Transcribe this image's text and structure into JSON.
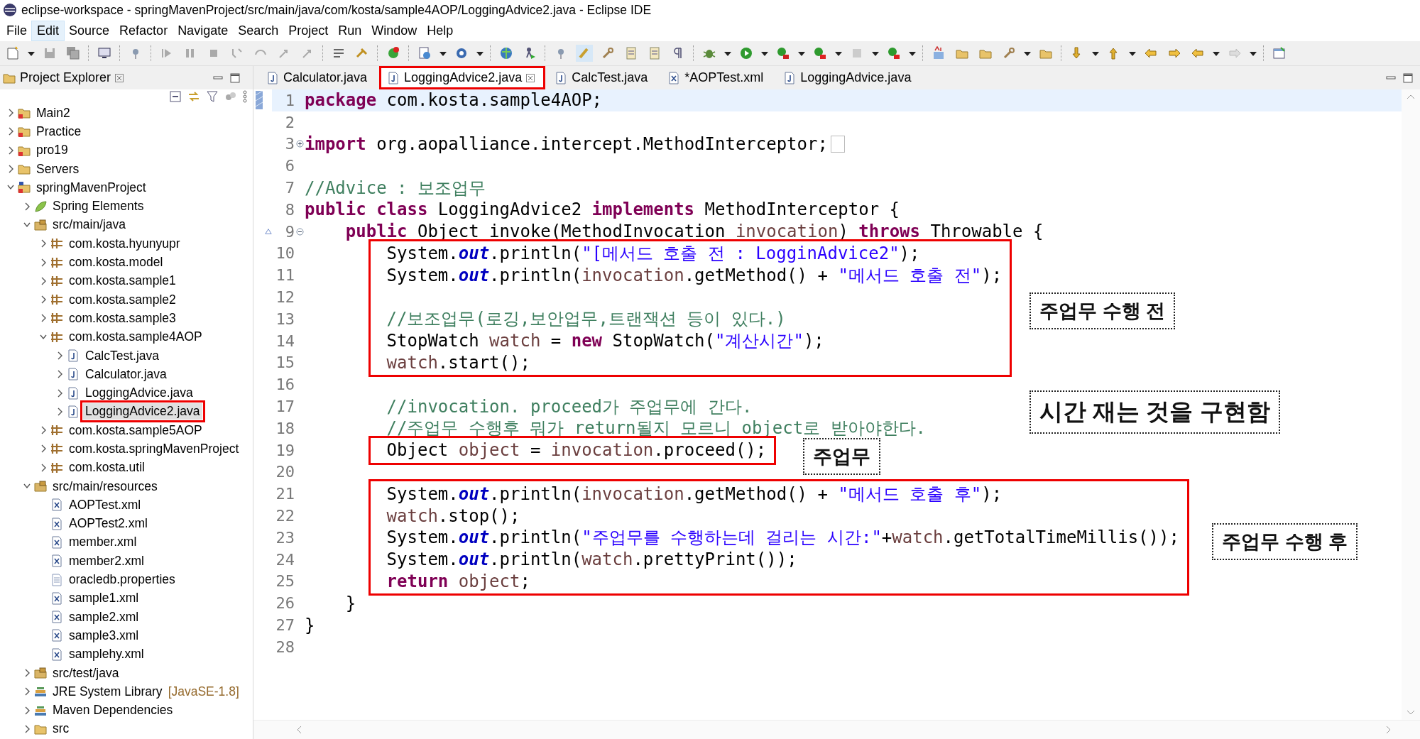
{
  "window": {
    "title": "eclipse-workspace - springMavenProject/src/main/java/com/kosta/sample4AOP/LoggingAdvice2.java - Eclipse IDE"
  },
  "menu": [
    {
      "label": "File",
      "selected": false
    },
    {
      "label": "Edit",
      "selected": true
    },
    {
      "label": "Source",
      "selected": false
    },
    {
      "label": "Refactor",
      "selected": false
    },
    {
      "label": "Navigate",
      "selected": false
    },
    {
      "label": "Search",
      "selected": false
    },
    {
      "label": "Project",
      "selected": false
    },
    {
      "label": "Run",
      "selected": false
    },
    {
      "label": "Window",
      "selected": false
    },
    {
      "label": "Help",
      "selected": false
    }
  ],
  "explorer": {
    "title": "Project Explorer",
    "items": [
      {
        "label": "Main2",
        "kind": "project",
        "expanded": false,
        "selected": false
      },
      {
        "label": "Practice",
        "kind": "project",
        "expanded": false,
        "selected": false
      },
      {
        "label": "pro19",
        "kind": "project",
        "expanded": false,
        "selected": false
      },
      {
        "label": "Servers",
        "kind": "folder",
        "expanded": false,
        "selected": false
      },
      {
        "label": "springMavenProject",
        "kind": "maven",
        "expanded": true,
        "selected": false,
        "children": [
          {
            "label": "Spring Elements",
            "kind": "spring",
            "expanded": false,
            "selected": false
          },
          {
            "label": "src/main/java",
            "kind": "source",
            "expanded": true,
            "selected": false,
            "children": [
              {
                "label": "com.kosta.hyunyupr",
                "kind": "package",
                "expanded": false,
                "selected": false
              },
              {
                "label": "com.kosta.model",
                "kind": "package",
                "expanded": false,
                "selected": false
              },
              {
                "label": "com.kosta.sample1",
                "kind": "package",
                "expanded": false,
                "selected": false
              },
              {
                "label": "com.kosta.sample2",
                "kind": "package",
                "expanded": false,
                "selected": false
              },
              {
                "label": "com.kosta.sample3",
                "kind": "package",
                "expanded": false,
                "selected": false
              },
              {
                "label": "com.kosta.sample4AOP",
                "kind": "package",
                "expanded": true,
                "selected": false,
                "children": [
                  {
                    "label": "CalcTest.java",
                    "kind": "java",
                    "expanded": false,
                    "selected": false
                  },
                  {
                    "label": "Calculator.java",
                    "kind": "java",
                    "expanded": false,
                    "selected": false
                  },
                  {
                    "label": "LoggingAdvice.java",
                    "kind": "java",
                    "expanded": false,
                    "selected": false
                  },
                  {
                    "label": "LoggingAdvice2.java",
                    "kind": "java",
                    "expanded": false,
                    "selected": true
                  }
                ]
              },
              {
                "label": "com.kosta.sample5AOP",
                "kind": "package",
                "expanded": false,
                "selected": false
              },
              {
                "label": "com.kosta.springMavenProject",
                "kind": "package",
                "expanded": false,
                "selected": false
              },
              {
                "label": "com.kosta.util",
                "kind": "package",
                "expanded": false,
                "selected": false
              }
            ]
          },
          {
            "label": "src/main/resources",
            "kind": "source",
            "expanded": true,
            "selected": false,
            "children": [
              {
                "label": "AOPTest.xml",
                "kind": "xml",
                "selected": false
              },
              {
                "label": "AOPTest2.xml",
                "kind": "xml",
                "selected": false
              },
              {
                "label": "member.xml",
                "kind": "xml",
                "selected": false
              },
              {
                "label": "member2.xml",
                "kind": "xml",
                "selected": false
              },
              {
                "label": "oracledb.properties",
                "kind": "properties",
                "selected": false
              },
              {
                "label": "sample1.xml",
                "kind": "xml",
                "selected": false
              },
              {
                "label": "sample2.xml",
                "kind": "xml",
                "selected": false
              },
              {
                "label": "sample3.xml",
                "kind": "xml",
                "selected": false
              },
              {
                "label": "samplehy.xml",
                "kind": "xml",
                "selected": false
              }
            ]
          },
          {
            "label": "src/test/java",
            "kind": "source",
            "expanded": false,
            "selected": false
          },
          {
            "label": "JRE System Library",
            "decoration": "[JavaSE-1.8]",
            "kind": "library",
            "expanded": false,
            "selected": false
          },
          {
            "label": "Maven Dependencies",
            "kind": "library",
            "expanded": false,
            "selected": false
          },
          {
            "label": "src",
            "kind": "folder",
            "expanded": false,
            "selected": false
          }
        ]
      }
    ]
  },
  "tabs": [
    {
      "label": "Calculator.java",
      "kind": "java",
      "selected": false
    },
    {
      "label": "LoggingAdvice2.java",
      "kind": "java",
      "selected": true
    },
    {
      "label": "CalcTest.java",
      "kind": "java",
      "selected": false
    },
    {
      "label": "*AOPTest.xml",
      "kind": "xml",
      "selected": false
    },
    {
      "label": "LoggingAdvice.java",
      "kind": "java",
      "selected": false
    }
  ],
  "code": [
    {
      "number": "1",
      "current": true,
      "changed": true,
      "override": false,
      "boxed": false,
      "tokens": [
        {
          "kind": "keyword",
          "text": "package"
        },
        {
          "kind": "plain",
          "text": " com.kosta.sample4AOP;"
        }
      ]
    },
    {
      "number": "2",
      "current": false,
      "changed": false,
      "override": false,
      "boxed": false
    },
    {
      "number": "3",
      "current": false,
      "changed": false,
      "override": false,
      "boxed": false,
      "folded": true,
      "tokens": [
        {
          "kind": "keyword",
          "text": "import"
        },
        {
          "kind": "plain",
          "text": " org.aopalliance.intercept.MethodInterceptor;"
        }
      ]
    },
    {
      "number": "6",
      "current": false,
      "changed": false,
      "override": false,
      "boxed": false
    },
    {
      "number": "7",
      "current": false,
      "changed": false,
      "override": false,
      "boxed": false,
      "tokens": [
        {
          "kind": "comment",
          "text": "//Advice : 보조업무"
        }
      ]
    },
    {
      "number": "8",
      "current": false,
      "changed": false,
      "override": false,
      "boxed": false,
      "tokens": [
        {
          "kind": "keyword",
          "text": "public class"
        },
        {
          "kind": "plain",
          "text": " LoggingAdvice2 "
        },
        {
          "kind": "keyword",
          "text": "implements"
        },
        {
          "kind": "plain",
          "text": " MethodInterceptor {"
        }
      ],
      "children": [
        {
          "number": "9",
          "current": false,
          "changed": false,
          "override": true,
          "boxed": false,
          "folded": false,
          "tokens": [
            {
              "kind": "keyword",
              "text": "public"
            },
            {
              "kind": "plain",
              "text": " Object invoke(MethodInvocation "
            },
            {
              "kind": "variable",
              "text": "invocation"
            },
            {
              "kind": "plain",
              "text": ") "
            },
            {
              "kind": "keyword",
              "text": "throws"
            },
            {
              "kind": "plain",
              "text": " Throwable {"
            }
          ],
          "children": [
            {
              "number": "10",
              "current": false,
              "changed": false,
              "override": false,
              "boxed": true,
              "tokens": [
                {
                  "kind": "plain",
                  "text": "System."
                },
                {
                  "kind": "field",
                  "text": "out"
                },
                {
                  "kind": "plain",
                  "text": ".println("
                },
                {
                  "kind": "string",
                  "text": "\"[메서드 호출 전 : LogginAdvice2\""
                },
                {
                  "kind": "plain",
                  "text": ");"
                }
              ]
            },
            {
              "number": "11",
              "current": false,
              "changed": false,
              "override": false,
              "boxed": true,
              "tokens": [
                {
                  "kind": "plain",
                  "text": "System."
                },
                {
                  "kind": "field",
                  "text": "out"
                },
                {
                  "kind": "plain",
                  "text": ".println("
                },
                {
                  "kind": "variable",
                  "text": "invocation"
                },
                {
                  "kind": "plain",
                  "text": ".getMethod() + "
                },
                {
                  "kind": "string",
                  "text": "\"메서드 호출 전\""
                },
                {
                  "kind": "plain",
                  "text": ");"
                }
              ]
            },
            {
              "number": "12",
              "current": false,
              "changed": false,
              "override": false,
              "boxed": true
            },
            {
              "number": "13",
              "current": false,
              "changed": false,
              "override": false,
              "boxed": true,
              "tokens": [
                {
                  "kind": "comment",
                  "text": "//보조업무(로깅,보안업무,트랜잭션 등이 있다.)"
                }
              ]
            },
            {
              "number": "14",
              "current": false,
              "changed": false,
              "override": false,
              "boxed": true,
              "tokens": [
                {
                  "kind": "plain",
                  "text": "StopWatch "
                },
                {
                  "kind": "variable",
                  "text": "watch"
                },
                {
                  "kind": "plain",
                  "text": " = "
                },
                {
                  "kind": "keyword",
                  "text": "new"
                },
                {
                  "kind": "plain",
                  "text": " StopWatch("
                },
                {
                  "kind": "string",
                  "text": "\"계산시간\""
                },
                {
                  "kind": "plain",
                  "text": ");"
                }
              ]
            },
            {
              "number": "15",
              "current": false,
              "changed": false,
              "override": false,
              "boxed": true,
              "tokens": [
                {
                  "kind": "variable",
                  "text": "watch"
                },
                {
                  "kind": "plain",
                  "text": ".start();"
                }
              ]
            },
            {
              "number": "16",
              "current": false,
              "changed": false,
              "override": false,
              "boxed": false
            },
            {
              "number": "17",
              "current": false,
              "changed": false,
              "override": false,
              "boxed": false,
              "tokens": [
                {
                  "kind": "comment",
                  "text": "//invocation. proceed가 주업무에 간다."
                }
              ]
            },
            {
              "number": "18",
              "current": false,
              "changed": false,
              "override": false,
              "boxed": false,
              "tokens": [
                {
                  "kind": "comment",
                  "text": "//주업무 수행후 뭐가 return될지 모르니 object로 받아야한다."
                }
              ]
            },
            {
              "number": "19",
              "current": false,
              "changed": false,
              "override": false,
              "boxed": true,
              "tokens": [
                {
                  "kind": "plain",
                  "text": "Object "
                },
                {
                  "kind": "variable",
                  "text": "object"
                },
                {
                  "kind": "plain",
                  "text": " = "
                },
                {
                  "kind": "variable",
                  "text": "invocation"
                },
                {
                  "kind": "plain",
                  "text": ".proceed();"
                }
              ]
            },
            {
              "number": "20",
              "current": false,
              "changed": false,
              "override": false,
              "boxed": false
            },
            {
              "number": "21",
              "current": false,
              "changed": false,
              "override": false,
              "boxed": true,
              "tokens": [
                {
                  "kind": "plain",
                  "text": "System."
                },
                {
                  "kind": "field",
                  "text": "out"
                },
                {
                  "kind": "plain",
                  "text": ".println("
                },
                {
                  "kind": "variable",
                  "text": "invocation"
                },
                {
                  "kind": "plain",
                  "text": ".getMethod() + "
                },
                {
                  "kind": "string",
                  "text": "\"메서드 호출 후\""
                },
                {
                  "kind": "plain",
                  "text": ");"
                }
              ]
            },
            {
              "number": "22",
              "current": false,
              "changed": false,
              "override": false,
              "boxed": true,
              "tokens": [
                {
                  "kind": "variable",
                  "text": "watch"
                },
                {
                  "kind": "plain",
                  "text": ".stop();"
                }
              ]
            },
            {
              "number": "23",
              "current": false,
              "changed": false,
              "override": false,
              "boxed": true,
              "tokens": [
                {
                  "kind": "plain",
                  "text": "System."
                },
                {
                  "kind": "field",
                  "text": "out"
                },
                {
                  "kind": "plain",
                  "text": ".println("
                },
                {
                  "kind": "string",
                  "text": "\"주업무를 수행하는데 걸리는 시간:\""
                },
                {
                  "kind": "plain",
                  "text": "+"
                },
                {
                  "kind": "variable",
                  "text": "watch"
                },
                {
                  "kind": "plain",
                  "text": ".getTotalTimeMillis());"
                }
              ]
            },
            {
              "number": "24",
              "current": false,
              "changed": false,
              "override": false,
              "boxed": true,
              "tokens": [
                {
                  "kind": "plain",
                  "text": "System."
                },
                {
                  "kind": "field",
                  "text": "out"
                },
                {
                  "kind": "plain",
                  "text": ".println("
                },
                {
                  "kind": "variable",
                  "text": "watch"
                },
                {
                  "kind": "plain",
                  "text": ".prettyPrint());"
                }
              ]
            },
            {
              "number": "25",
              "current": false,
              "changed": false,
              "override": false,
              "boxed": true,
              "tokens": [
                {
                  "kind": "keyword",
                  "text": "return "
                },
                {
                  "kind": "variable",
                  "text": "object"
                },
                {
                  "kind": "plain",
                  "text": ";"
                }
              ]
            }
          ]
        },
        {
          "number": "26",
          "current": false,
          "changed": false,
          "override": false,
          "boxed": false,
          "tokens": [
            {
              "kind": "plain",
              "text": "}"
            }
          ]
        }
      ]
    },
    {
      "number": "27",
      "current": false,
      "changed": false,
      "override": false,
      "boxed": false,
      "tokens": [
        {
          "kind": "plain",
          "text": "}"
        }
      ]
    },
    {
      "number": "28",
      "current": false,
      "changed": false,
      "override": false,
      "boxed": false
    }
  ],
  "callouts": [
    {
      "text": "주업무 수행 전"
    },
    {
      "text": "시간 재는 것을 구현함"
    },
    {
      "text": "주업무"
    },
    {
      "text": "주업무 수행 후"
    }
  ]
}
